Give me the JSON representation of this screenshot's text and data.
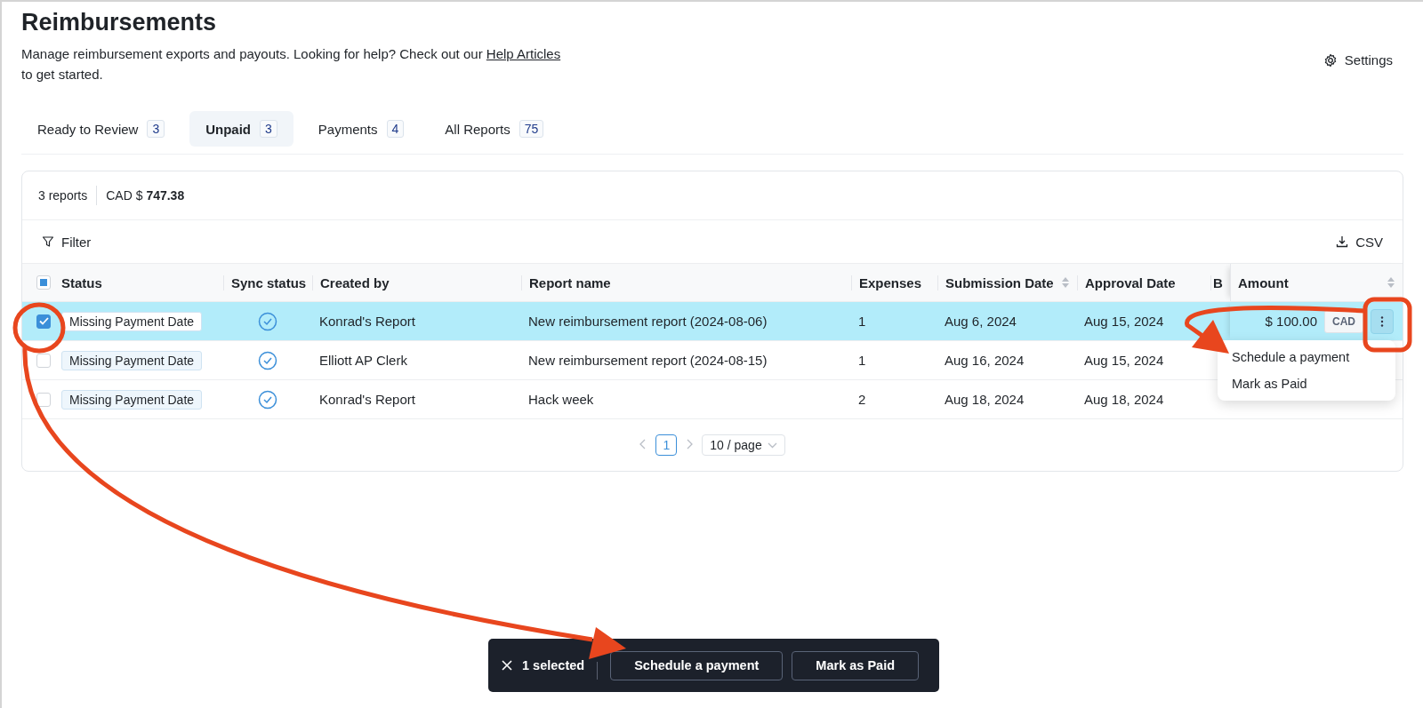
{
  "header": {
    "title": "Reimbursements",
    "description_before": "Manage reimbursement exports and payouts. Looking for help? Check out our ",
    "help_link": "Help Articles",
    "description_after": " to get started.",
    "settings": "Settings"
  },
  "tabs": [
    {
      "label": "Ready to Review",
      "count": "3",
      "selected": false
    },
    {
      "label": "Unpaid",
      "count": "3",
      "selected": true
    },
    {
      "label": "Payments",
      "count": "4",
      "selected": false
    },
    {
      "label": "All Reports",
      "count": "75",
      "selected": false
    }
  ],
  "summary": {
    "reports": "3 reports",
    "total": "CAD $ **747.38**"
  },
  "toolbar": {
    "filter": "Filter",
    "export": "CSV"
  },
  "table": {
    "header_checkbox": {
      "indeterminate": true
    },
    "columns": [
      {
        "label": "Status",
        "sortable": false
      },
      {
        "label": "Sync status",
        "sortable": false
      },
      {
        "label": "Created by",
        "sortable": false
      },
      {
        "label": "Report name",
        "sortable": false
      },
      {
        "label": "Expenses",
        "sortable": false
      },
      {
        "label": "Submission Date",
        "sortable": true
      },
      {
        "label": "Approval Date",
        "sortable": false
      },
      {
        "label": "B",
        "sortable": false
      },
      {
        "label": "Amount",
        "sortable": true
      }
    ],
    "rows": [
      {
        "selected": true,
        "status": "Missing Payment Date",
        "synced": true,
        "created_by": "Konrad's Report",
        "report_name": "New reimbursement report (2024-08-06)",
        "expenses": "1",
        "submission_date": "Aug 6, 2024",
        "approval_date": "Aug 15, 2024",
        "amount": "$ 100.00",
        "currency": "CAD"
      },
      {
        "selected": false,
        "status": "Missing Payment Date",
        "synced": true,
        "created_by": "Elliott AP Clerk",
        "report_name": "New reimbursement report (2024-08-15)",
        "expenses": "1",
        "submission_date": "Aug 16, 2024",
        "approval_date": "Aug 15, 2024"
      },
      {
        "selected": false,
        "status": "Missing Payment Date",
        "synced": true,
        "created_by": "Konrad's Report",
        "report_name": "Hack week",
        "expenses": "2",
        "submission_date": "Aug 18, 2024",
        "approval_date": "Aug 18, 2024"
      }
    ],
    "menu": [
      "Schedule a payment",
      "Mark as Paid"
    ]
  },
  "pagination": {
    "pages": [
      {
        "label": "1",
        "selected": true
      }
    ],
    "page_size": "10 / page"
  },
  "action_bar": {
    "count": "1 selected",
    "buttons": [
      "Schedule a payment",
      "Mark as Paid"
    ]
  }
}
